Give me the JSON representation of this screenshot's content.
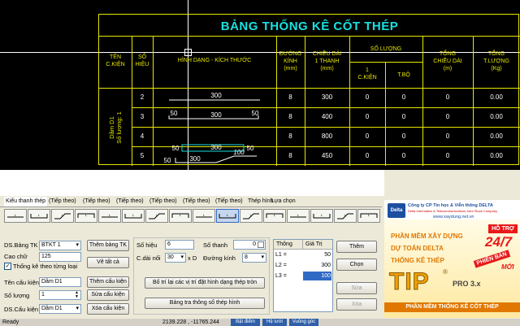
{
  "table": {
    "title": "BẢNG THỐNG KÊ CỐT THÉP",
    "headers": {
      "ten_ck": [
        "TÊN",
        "C.KIỆN"
      ],
      "so_hieu": [
        "SỐ",
        "HIỆU"
      ],
      "hinh_dang": "HÌNH DẠNG - KÍCH THƯỚC",
      "duong_kinh": [
        "ĐƯỜNG",
        "KÍNH",
        "(mm)"
      ],
      "chieu_dai": [
        "CHIỀU DÀI",
        "1 THANH",
        "(mm)"
      ],
      "so_luong": "SỐ LƯỢNG",
      "sl_ck": [
        "1",
        "C.KIỆN"
      ],
      "sl_tb": "T.BỘ",
      "tong_cd": [
        "TỔNG",
        "CHIỀU DÀI",
        "(m)"
      ],
      "tong_tl": [
        "TỔNG",
        "T.LƯỢNG",
        "(Kg)"
      ]
    },
    "member": "Dầm D1",
    "member_qty": "Số lượng: 1",
    "rows": [
      {
        "no": "2",
        "dim": [
          "300"
        ],
        "dk": "8",
        "cd": "300",
        "sl1": "0",
        "tb": "0",
        "tcd": "0",
        "ttl": "0.00"
      },
      {
        "no": "3",
        "dim": [
          "50",
          "300",
          "50"
        ],
        "dk": "8",
        "cd": "400",
        "sl1": "0",
        "tb": "0",
        "tcd": "0",
        "ttl": "0.00"
      },
      {
        "no": "4",
        "dim": [
          "50",
          "300",
          "50"
        ],
        "dk": "8",
        "cd": "800",
        "sl1": "0",
        "tb": "0",
        "tcd": "0",
        "ttl": "0.00"
      },
      {
        "no": "5",
        "dim": [
          "50",
          "300",
          "100"
        ],
        "dk": "8",
        "cd": "450",
        "sl1": "0",
        "tb": "0",
        "tcd": "0",
        "ttl": "0.00"
      }
    ]
  },
  "tabs": [
    "Kiểu thanh thép",
    "(Tiếp theo)",
    "(Tiếp theo)",
    "(Tiếp theo)",
    "(Tiếp theo)",
    "(Tiếp theo)",
    "(Tiếp theo)",
    "Thép hình",
    "Lựa chọn"
  ],
  "form": {
    "ds_bang_tk_label": "DS.Bảng TK",
    "ds_bang_tk_value": "BTKT 1",
    "them_bang_tk": "Thêm bảng TK",
    "cao_chu_label": "Cao chữ",
    "cao_chu_value": "125",
    "ve_tat_ca": "Vẽ tất cả",
    "thong_ke_theo_tung_loai": "Thống kê theo từng loại",
    "ten_cau_kien_label": "Tên cấu kiện",
    "ten_cau_kien_value": "Dầm D1",
    "them_cau_kien": "Thêm cấu kiện",
    "so_luong_label": "Số lượng",
    "so_luong_value": "1",
    "sua_cau_kien": "Sửa cấu kiện",
    "ds_cau_kien_label": "DS.Cấu kiện",
    "ds_cau_kien_value": "Dầm D1",
    "xoa_cau_kien": "Xóa cấu kiện",
    "so_hieu_label": "Số hiệu",
    "so_hieu_value": "6",
    "so_thanh_label": "Số thanh",
    "so_thanh_value": "0",
    "c_dai_noi_label": "C.dài nối",
    "c_dai_noi_value": "30",
    "xd_label": "x D",
    "duong_kinh_label": "Đường kính",
    "duong_kinh_value": "8",
    "bo_tri_btn": "Bố trí lại các vị trí đặt hình dạng thép tròn",
    "bang_tra_btn": "Bảng tra thông số thép hình"
  },
  "grid": {
    "h1": "Thông",
    "h2": "Giá Trị",
    "rows": [
      {
        "k": "L1 =",
        "v": "50"
      },
      {
        "k": "L2 =",
        "v": "300"
      },
      {
        "k": "L3 =",
        "v": "100"
      }
    ]
  },
  "side_buttons": {
    "them": "Thêm",
    "chon": "Chọn",
    "sua": "Sửa",
    "xoa": "Xóa"
  },
  "ad": {
    "logo": "Delta",
    "company": "Công ty CP Tin học & Viễn thông DELTA",
    "company_en": "Delta Informatics & Telecommunications Joint Stock Company",
    "url": "www.xaydung.net.vn",
    "line1": "PHẦN MỀM XÂY DỰNG",
    "line2": "DỰ TOÁN DELTA",
    "line3": "THỐNG KÊ THÉP",
    "hotro": "HỖ TRỢ",
    "h247": "24/7",
    "phienban": "PHIÊN BẢN",
    "moi": "MỚI",
    "tip": "TIP",
    "reg": "®",
    "pro": "PRO 3.x",
    "bottom": "PHẦN MỀM THỐNG KÊ CỐT THÉP"
  },
  "status": {
    "ready": "Ready",
    "coords": "2139.228 , -11765.244",
    "b1": "Bật điểm",
    "b2": "Hệ lưới",
    "b3": "Vuông góc"
  }
}
